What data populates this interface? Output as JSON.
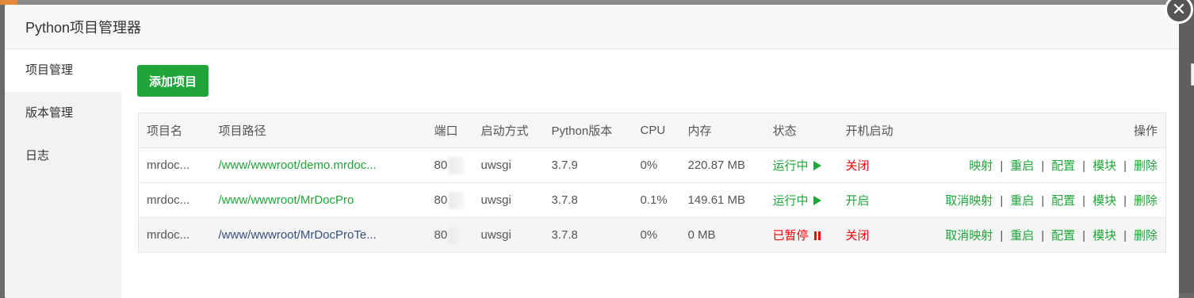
{
  "dialog": {
    "title": "Python项目管理器",
    "close_glyph": "✕"
  },
  "sidebar": {
    "items": [
      {
        "label": "项目管理",
        "active": true
      },
      {
        "label": "版本管理",
        "active": false
      },
      {
        "label": "日志",
        "active": false
      }
    ]
  },
  "toolbar": {
    "add_label": "添加项目"
  },
  "table": {
    "headers": {
      "name": "项目名",
      "path": "项目路径",
      "port": "端口",
      "start_mode": "启动方式",
      "python_version": "Python版本",
      "cpu": "CPU",
      "memory": "内存",
      "status": "状态",
      "boot": "开机启动",
      "actions": "操作"
    },
    "rows": [
      {
        "name": "mrdoc...",
        "path": "/www/wwwroot/demo.mrdoc...",
        "port": "80",
        "start_mode": "uwsgi",
        "python_version": "3.7.9",
        "cpu": "0%",
        "memory": "220.87 MB",
        "status": "运行中",
        "boot": "关闭",
        "map_action": "映射",
        "restart": "重启",
        "config": "配置",
        "module": "模块",
        "delete": "删除"
      },
      {
        "name": "mrdoc...",
        "path": "/www/wwwroot/MrDocPro",
        "port": "80",
        "start_mode": "uwsgi",
        "python_version": "3.7.8",
        "cpu": "0.1%",
        "memory": "149.61 MB",
        "status": "运行中",
        "boot": "开启",
        "map_action": "取消映射",
        "restart": "重启",
        "config": "配置",
        "module": "模块",
        "delete": "删除"
      },
      {
        "name": "mrdoc...",
        "path": "/www/wwwroot/MrDocProTe...",
        "port": "80",
        "start_mode": "uwsgi",
        "python_version": "3.7.8",
        "cpu": "0%",
        "memory": "0 MB",
        "status": "已暂停",
        "boot": "关闭",
        "map_action": "取消映射",
        "restart": "重启",
        "config": "配置",
        "module": "模块",
        "delete": "删除"
      }
    ],
    "separator": "|"
  },
  "colors": {
    "accent": "#20a53a",
    "danger": "#ef0808",
    "link_dark": "#34507a"
  }
}
